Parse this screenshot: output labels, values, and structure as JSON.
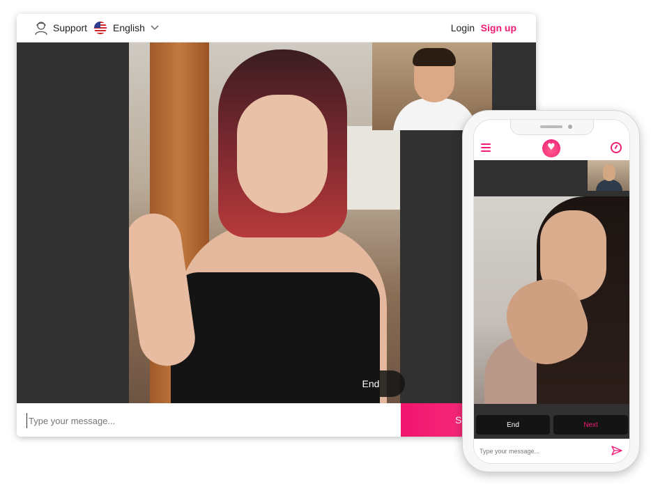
{
  "desktop": {
    "header": {
      "support_label": "Support",
      "language_label": "English",
      "login_label": "Login",
      "signup_label": "Sign up"
    },
    "video": {
      "end_label": "End"
    },
    "chat": {
      "placeholder": "Type your message...",
      "send_label": "S"
    }
  },
  "phone": {
    "controls": {
      "end_label": "End",
      "next_label": "Next"
    },
    "chat": {
      "placeholder": "Type your message..."
    }
  },
  "colors": {
    "accent": "#ef1b74",
    "video_bg": "#313131"
  },
  "icons": {
    "support": "support-agent-icon",
    "flag": "us-flag-icon",
    "language_chevron": "chevron-down-icon",
    "menu": "hamburger-menu-icon",
    "logo": "heart-logo-icon",
    "timer": "timer-icon",
    "send": "send-icon"
  }
}
